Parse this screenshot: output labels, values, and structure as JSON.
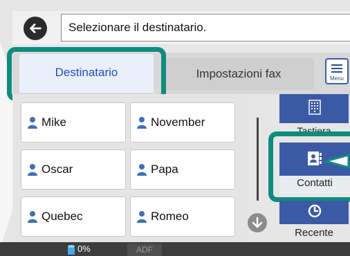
{
  "header": {
    "instruction": "Selezionare il destinatario."
  },
  "tabs": [
    {
      "label": "Destinatario",
      "active": true
    },
    {
      "label": "Impostazioni fax",
      "active": false
    }
  ],
  "menu_button": {
    "label": "Menu",
    "icon": "menu-icon"
  },
  "contacts": [
    {
      "name": "Mike"
    },
    {
      "name": "November"
    },
    {
      "name": "Oscar"
    },
    {
      "name": "Papa"
    },
    {
      "name": "Quebec"
    },
    {
      "name": "Romeo"
    }
  ],
  "side_buttons": [
    {
      "label": "Tastiera",
      "icon": "keypad-icon"
    },
    {
      "label": "Contatti",
      "icon": "contacts-book-icon"
    },
    {
      "label": "Recente",
      "icon": "clock-icon"
    }
  ],
  "status": {
    "paper_level": "0%",
    "adf_label": "ADF"
  },
  "colors": {
    "accent_blue": "#3b5aa6",
    "highlight_teal": "#0f8c7f",
    "active_tab_text": "#1f4fc0"
  }
}
